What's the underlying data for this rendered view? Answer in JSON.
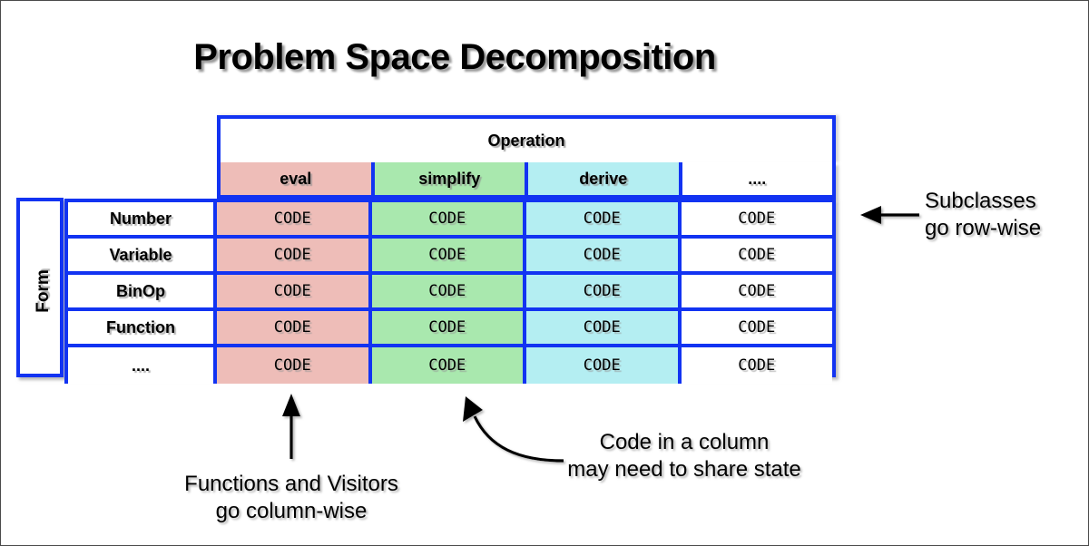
{
  "title": "Problem Space Decomposition",
  "table": {
    "operation_header": "Operation",
    "form_header": "Form",
    "columns": [
      {
        "label": "eval",
        "color": "#EEBDB8"
      },
      {
        "label": "simplify",
        "color": "#A9E8AE"
      },
      {
        "label": "derive",
        "color": "#B4EEF2"
      },
      {
        "label": "....",
        "color": "#FFFFFF"
      }
    ],
    "rows": [
      {
        "label": "Number",
        "cells": [
          "CODE",
          "CODE",
          "CODE",
          "CODE"
        ]
      },
      {
        "label": "Variable",
        "cells": [
          "CODE",
          "CODE",
          "CODE",
          "CODE"
        ]
      },
      {
        "label": "BinOp",
        "cells": [
          "CODE",
          "CODE",
          "CODE",
          "CODE"
        ]
      },
      {
        "label": "Function",
        "cells": [
          "CODE",
          "CODE",
          "CODE",
          "CODE"
        ]
      },
      {
        "label": "....",
        "cells": [
          "CODE",
          "CODE",
          "CODE",
          "CODE"
        ]
      }
    ],
    "border_color": "#1233F2"
  },
  "annotations": {
    "subclasses": "Subclasses\ngo row-wise",
    "functions": "Functions and Visitors\ngo column-wise",
    "share_state": "Code in a column\nmay need to share state"
  }
}
